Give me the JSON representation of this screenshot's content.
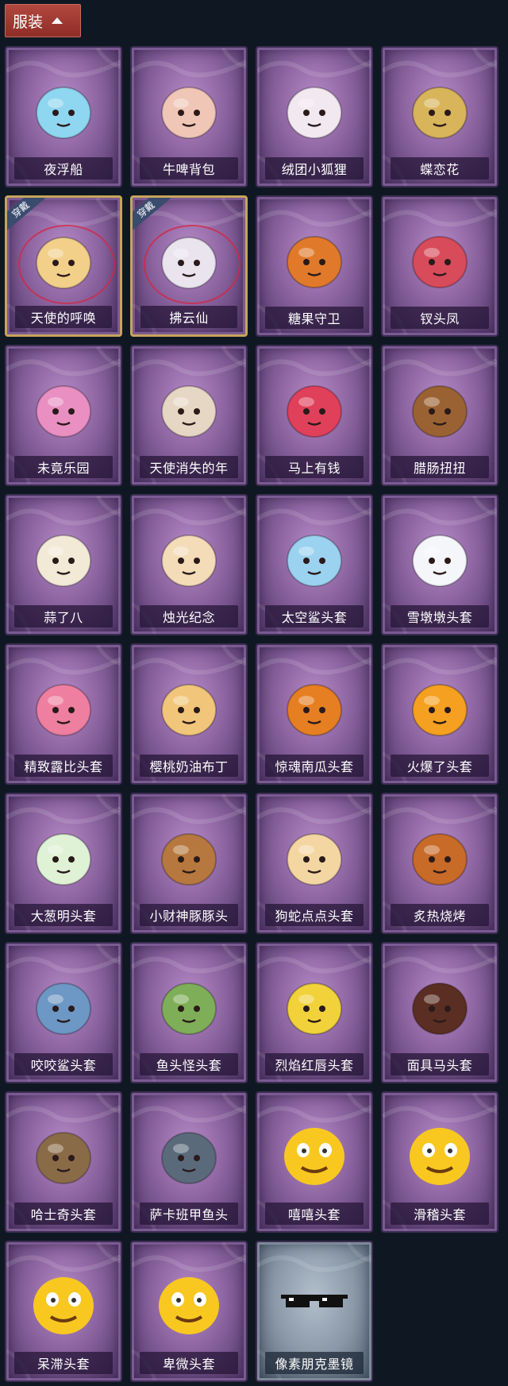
{
  "header": {
    "title": "服装"
  },
  "badge_label": "穿戴",
  "items": [
    {
      "name": "夜浮船",
      "icon": "jellyfish-icon",
      "color": "#8fd6f0",
      "equipped": false
    },
    {
      "name": "牛啤背包",
      "icon": "cow-beer-barrel-icon",
      "color": "#f0c6b6",
      "equipped": false
    },
    {
      "name": "绒团小狐狸",
      "icon": "fox-keychain-icon",
      "color": "#f1e8f0",
      "equipped": false
    },
    {
      "name": "蝶恋花",
      "icon": "butterfly-bell-icon",
      "color": "#d8b45a",
      "equipped": false
    },
    {
      "name": "天使的呼唤",
      "icon": "angel-doll-icon",
      "color": "#f2d08a",
      "equipped": true
    },
    {
      "name": "拂云仙",
      "icon": "fairy-keychain-icon",
      "color": "#e9e4ee",
      "equipped": true
    },
    {
      "name": "糖果守卫",
      "icon": "pumpkin-scarecrow-icon",
      "color": "#e07a2a",
      "equipped": false
    },
    {
      "name": "钗头凤",
      "icon": "phoenix-crown-doll-icon",
      "color": "#d84b5a",
      "equipped": false
    },
    {
      "name": "未竟乐园",
      "icon": "clown-girl-icon",
      "color": "#e98fc2",
      "equipped": false
    },
    {
      "name": "天使消失的年",
      "icon": "sleeping-angel-icon",
      "color": "#e6d7c4",
      "equipped": false
    },
    {
      "name": "马上有钱",
      "icon": "red-horse-head-icon",
      "color": "#e0405a",
      "equipped": false
    },
    {
      "name": "腊肠扭扭",
      "icon": "dachshund-head-icon",
      "color": "#9a6232",
      "equipped": false
    },
    {
      "name": "蒜了八",
      "icon": "garlic-head-icon",
      "color": "#f2ead6",
      "equipped": false
    },
    {
      "name": "烛光纪念",
      "icon": "candle-head-icon",
      "color": "#f4dcb8",
      "equipped": false
    },
    {
      "name": "太空鲨头套",
      "icon": "space-shark-head-icon",
      "color": "#9ad2f0",
      "equipped": false
    },
    {
      "name": "雪墩墩头套",
      "icon": "snowman-head-icon",
      "color": "#f4f6fa",
      "equipped": false
    },
    {
      "name": "精致露比头套",
      "icon": "pink-beaver-head-icon",
      "color": "#ee7fa0",
      "equipped": false
    },
    {
      "name": "樱桃奶油布丁",
      "icon": "pudding-head-icon",
      "color": "#f1c67a",
      "equipped": false
    },
    {
      "name": "惊魂南瓜头套",
      "icon": "jack-o-lantern-icon",
      "color": "#e67e22",
      "equipped": false
    },
    {
      "name": "火爆了头套",
      "icon": "fire-head-icon",
      "color": "#f5a020",
      "equipped": false
    },
    {
      "name": "大葱明头套",
      "icon": "scallion-head-icon",
      "color": "#dff2d6",
      "equipped": false
    },
    {
      "name": "小财神豚豚头",
      "icon": "capybara-head-icon",
      "color": "#b6783e",
      "equipped": false
    },
    {
      "name": "狗蛇点点头套",
      "icon": "dog-snake-head-icon",
      "color": "#f4d6a2",
      "equipped": false
    },
    {
      "name": "炙热烧烤",
      "icon": "bbq-head-icon",
      "color": "#c86a28",
      "equipped": false
    },
    {
      "name": "咬咬鲨头套",
      "icon": "shark-head-icon",
      "color": "#6d97c4",
      "equipped": false
    },
    {
      "name": "鱼头怪头套",
      "icon": "fish-monster-head-icon",
      "color": "#7fae58",
      "equipped": false
    },
    {
      "name": "烈焰红唇头套",
      "icon": "yellow-mouse-head-icon",
      "color": "#f2d23a",
      "equipped": false
    },
    {
      "name": "面具马头套",
      "icon": "horse-mask-icon",
      "color": "#5a2e22",
      "equipped": false
    },
    {
      "name": "哈士奇头套",
      "icon": "husky-head-icon",
      "color": "#8a6b48",
      "equipped": false
    },
    {
      "name": "萨卡班甲鱼头",
      "icon": "sacabambaspis-head-icon",
      "color": "#5a6a7a",
      "equipped": false
    },
    {
      "name": "嘻嘻头套",
      "icon": "grinning-emoji-head-icon",
      "color": "#f8c820",
      "equipped": false
    },
    {
      "name": "滑稽头套",
      "icon": "smirk-emoji-head-icon",
      "color": "#f8c820",
      "equipped": false
    },
    {
      "name": "呆滞头套",
      "icon": "dazed-emoji-head-icon",
      "color": "#f8c820",
      "equipped": false
    },
    {
      "name": "卑微头套",
      "icon": "humble-emoji-head-icon",
      "color": "#f8c820",
      "equipped": false
    },
    {
      "name": "像素朋克墨镜",
      "icon": "pixel-sunglasses-icon",
      "color": "#111111",
      "equipped": false,
      "plain": true
    }
  ]
}
